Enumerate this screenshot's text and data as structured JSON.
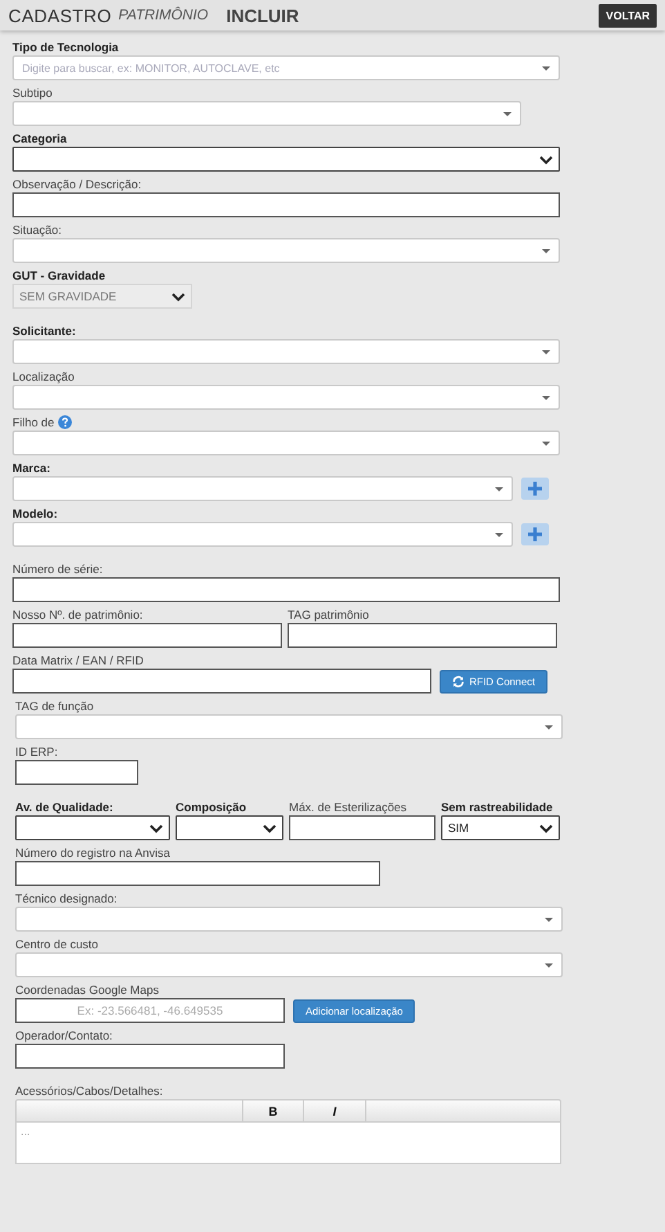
{
  "header": {
    "title": "CADASTRO",
    "subtitle": "PATRIMÔNIO",
    "action": "INCLUIR",
    "back_button": "VOLTAR"
  },
  "fields": [
    {
      "kind": "combo",
      "label": "Tipo de Tecnologia",
      "required": true,
      "placeholder": "Digite para buscar, ex: MONITOR, AUTOCLAVE, etc"
    },
    {
      "kind": "combo",
      "label": "Subtipo",
      "required": false
    },
    {
      "kind": "select",
      "label": "Categoria",
      "required": true
    },
    {
      "kind": "text",
      "label": "Observação / Descrição:",
      "required": false
    },
    {
      "kind": "combo",
      "label": "Situação:",
      "required": false
    },
    {
      "kind": "grey_select",
      "label": "GUT - Gravidade",
      "required": true,
      "value": "SEM GRAVIDADE"
    },
    {
      "kind": "combo",
      "label": "Solicitante:",
      "required": true
    },
    {
      "kind": "combo",
      "label": "Localização",
      "required": false
    },
    {
      "kind": "combo",
      "label": "Filho de",
      "required": false,
      "help_icon": true
    },
    {
      "kind": "combo",
      "label": "Marca:",
      "required": true,
      "add_button": true
    },
    {
      "kind": "combo",
      "label": "Modelo:",
      "required": true,
      "add_button": true
    },
    {
      "kind": "text",
      "label": "Número de série:",
      "required": false
    },
    {
      "kind": "row",
      "fields": [
        {
          "kind": "text",
          "label": "Nosso Nº. de patrimônio:",
          "required": false
        },
        {
          "kind": "text",
          "label": "TAG patrimônio",
          "required": false
        }
      ]
    },
    {
      "kind": "text",
      "label": "Data Matrix / EAN / RFID",
      "required": false,
      "button": "RFID Connect"
    },
    {
      "kind": "combo",
      "label": "TAG de função",
      "required": false
    },
    {
      "kind": "text",
      "label": "ID ERP:",
      "required": false
    },
    {
      "kind": "row",
      "fields": [
        {
          "kind": "select",
          "label": "Av. de Qualidade:",
          "required": true
        },
        {
          "kind": "select",
          "label": "Composição",
          "required": true
        },
        {
          "kind": "text",
          "label": "Máx. de Esterilizações",
          "required": false
        },
        {
          "kind": "select",
          "label": "Sem rastreabilidade",
          "required": true,
          "value": "SIM"
        }
      ]
    },
    {
      "kind": "text",
      "label": "Número do registro na Anvisa",
      "required": false
    },
    {
      "kind": "combo",
      "label": "Técnico designado:",
      "required": false
    },
    {
      "kind": "combo",
      "label": "Centro de custo",
      "required": false
    },
    {
      "kind": "text",
      "label": "Coordenadas Google Maps",
      "required": false,
      "placeholder": "Ex: -23.566481, -46.649535",
      "button": "Adicionar localização"
    },
    {
      "kind": "text",
      "label": "Operador/Contato:",
      "required": false
    },
    {
      "kind": "editor",
      "label": "Acessórios/Cabos/Detalhes:",
      "required": false,
      "toolbar": [
        "B",
        "I"
      ],
      "placeholder": "..."
    }
  ]
}
